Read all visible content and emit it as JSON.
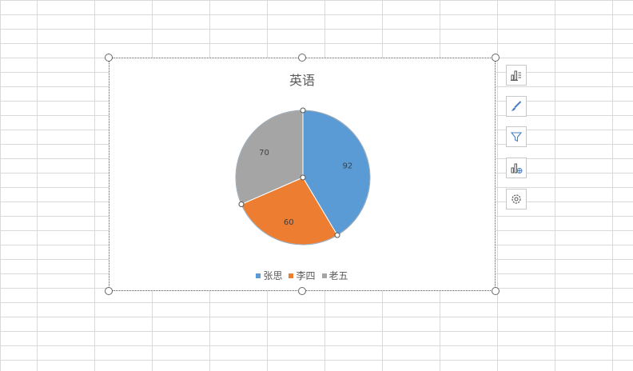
{
  "chart_data": {
    "type": "pie",
    "title": "英语",
    "categories": [
      "张思",
      "李四",
      "老五"
    ],
    "values": [
      92,
      60,
      70
    ],
    "data_labels": [
      "92",
      "60",
      "70"
    ],
    "legend_position": "bottom",
    "colors": [
      "#5b9bd5",
      "#ed7d31",
      "#a5a5a5"
    ]
  },
  "chart_tools": [
    {
      "name": "chart-elements-icon"
    },
    {
      "name": "chart-styles-icon"
    },
    {
      "name": "chart-filters-icon"
    },
    {
      "name": "chart-layout-icon"
    },
    {
      "name": "chart-settings-icon"
    }
  ]
}
